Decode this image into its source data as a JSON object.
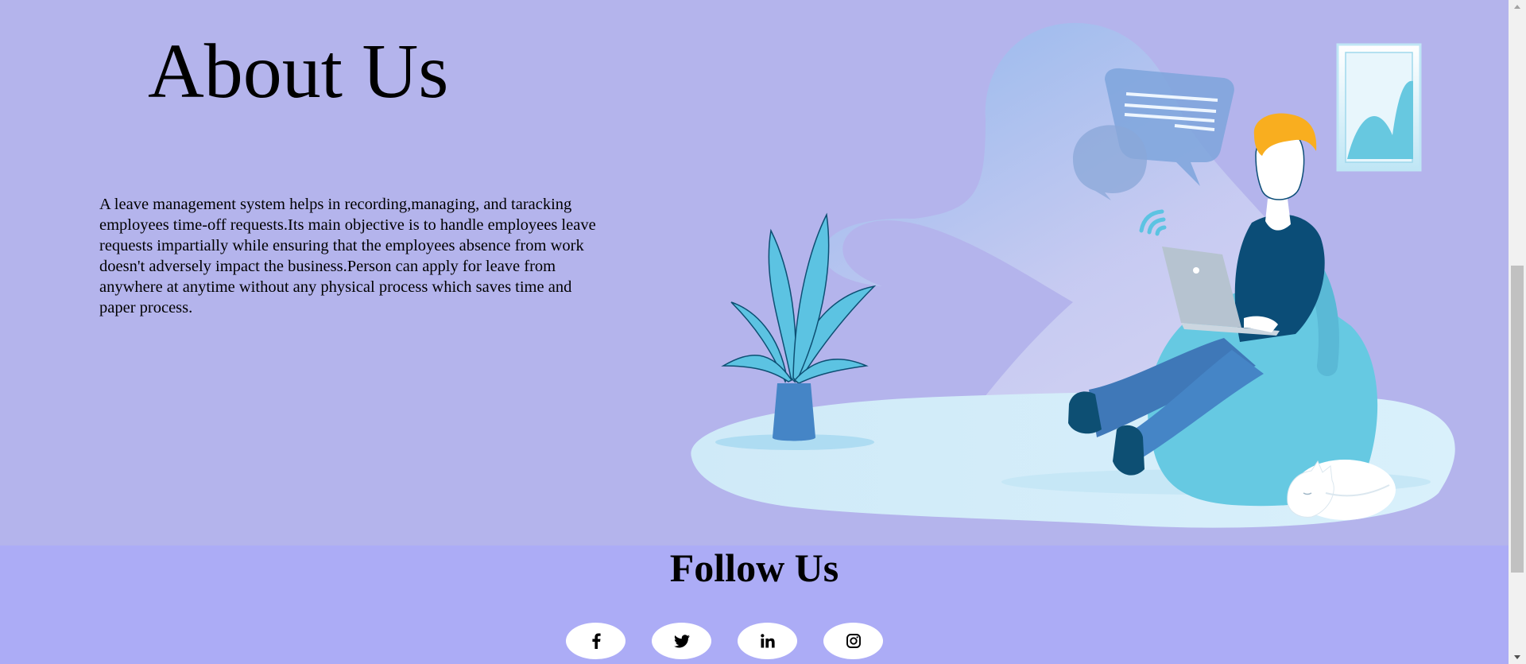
{
  "about": {
    "title": "About Us",
    "paragraph": "A leave management system helps in recording,managing, and taracking employees time-off requests.Its main objective is to handle employees leave requests impartially while ensuring that the employees absence from work doesn't adversely impact the business.Person can apply for leave from anywhere at anytime without any physical process which saves time and paper process."
  },
  "follow": {
    "title": "Follow Us",
    "social": [
      {
        "name": "facebook",
        "icon": "facebook-icon"
      },
      {
        "name": "twitter",
        "icon": "twitter-icon"
      },
      {
        "name": "linkedin",
        "icon": "linkedin-icon"
      },
      {
        "name": "instagram",
        "icon": "instagram-icon"
      }
    ]
  },
  "colors": {
    "about_background": "#b4b4ec",
    "follow_background": "#acacf6",
    "button_background": "#ffffff"
  }
}
